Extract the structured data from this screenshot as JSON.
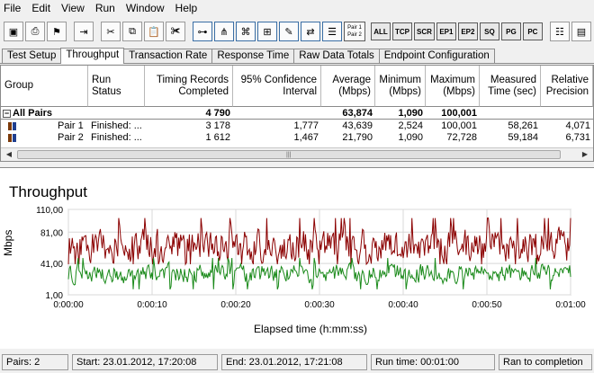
{
  "menu": [
    "File",
    "Edit",
    "View",
    "Run",
    "Window",
    "Help"
  ],
  "toolbar": {
    "text_buttons": [
      "ALL",
      "TCP",
      "SCR",
      "EP1",
      "EP2",
      "SQ",
      "PG",
      "PC"
    ],
    "pair_button": [
      "Pair 1",
      "Pair 2"
    ]
  },
  "tabs": [
    "Test Setup",
    "Throughput",
    "Transaction Rate",
    "Response Time",
    "Raw Data Totals",
    "Endpoint Configuration"
  ],
  "active_tab": "Throughput",
  "table": {
    "headers": [
      "Group",
      "Run Status",
      "Timing Records Completed",
      "95% Confidence Interval",
      "Average (Mbps)",
      "Minimum (Mbps)",
      "Maximum (Mbps)",
      "Measured Time (sec)",
      "Relative Precision"
    ],
    "total": {
      "group": "All Pairs",
      "status": "",
      "records": "4 790",
      "ci": "",
      "avg": "63,874",
      "min": "1,090",
      "max": "100,001",
      "time": "",
      "precision": ""
    },
    "rows": [
      {
        "group": "Pair 1",
        "status": "Finished: ...",
        "records": "3 178",
        "ci": "1,777",
        "avg": "43,639",
        "min": "2,524",
        "max": "100,001",
        "time": "58,261",
        "precision": "4,071"
      },
      {
        "group": "Pair 2",
        "status": "Finished: ...",
        "records": "1 612",
        "ci": "1,467",
        "avg": "21,790",
        "min": "1,090",
        "max": "72,728",
        "time": "59,184",
        "precision": "6,731"
      }
    ]
  },
  "chart_data": {
    "type": "line",
    "title": "Throughput",
    "xlabel": "Elapsed time (h:mm:ss)",
    "ylabel": "Mbps",
    "ylim": [
      1.0,
      110.0
    ],
    "y_ticks": [
      "110,00",
      "81,00",
      "41,00",
      "1,00"
    ],
    "y_tick_values": [
      110,
      81,
      41,
      1
    ],
    "x_ticks": [
      "0:00:00",
      "0:00:10",
      "0:00:20",
      "0:00:30",
      "0:00:40",
      "0:00:50",
      "0:01:00"
    ],
    "xlim_seconds": [
      0,
      60
    ],
    "series": [
      {
        "color": "#8b0000",
        "mean": 63,
        "spread": 18,
        "min": 40,
        "max": 100
      },
      {
        "color": "#1a8a1a",
        "mean": 28,
        "spread": 10,
        "min": 1,
        "max": 72
      }
    ]
  },
  "status": {
    "pairs": "Pairs: 2",
    "start": "Start: 23.01.2012, 17:20:08",
    "end": "End: 23.01.2012, 17:21:08",
    "run_time": "Run time: 00:01:00",
    "result": "Ran to completion"
  }
}
